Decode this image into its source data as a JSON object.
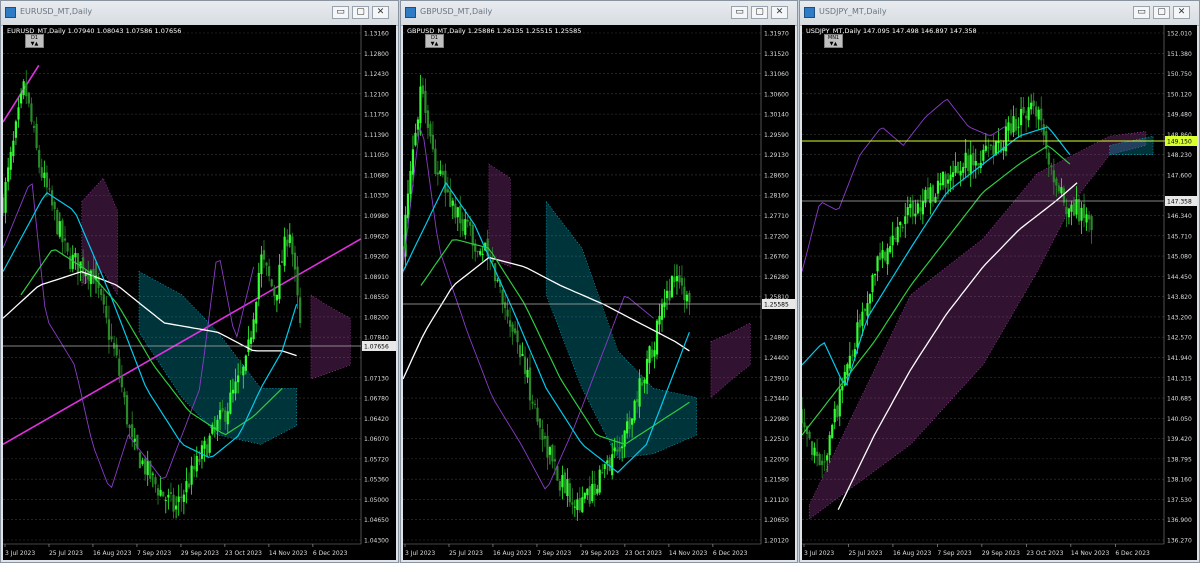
{
  "colors": {
    "background": "#000000",
    "bull": "#32ff32",
    "bear": "#2a8a2a",
    "tenkan": "#00ccee",
    "kijun": "#2ecc40",
    "senkou_ma": "#ffffff",
    "chikou": "#8a3cc8",
    "cloud_up": "#00bcd4",
    "cloud_down": "#b040b0",
    "trendline": "#e030e0",
    "level": "#d8ff30"
  },
  "windows": [
    {
      "id": "eurusd",
      "title": "EURUSD_MT,Daily",
      "symbol_line": "EURUSD_MT,Daily  1.07940 1.08043 1.07586 1.07656",
      "tf_label": "D1",
      "tf_arrows": "▼▲",
      "price_labels": [
        "1.13160",
        "1.12800",
        "1.12430",
        "1.12100",
        "1.11750",
        "1.11390",
        "1.11050",
        "1.10680",
        "1.10330",
        "1.09980",
        "1.09620",
        "1.09260",
        "1.08910",
        "1.08550",
        "1.08200",
        "1.07840",
        "1.07656",
        "1.07130",
        "1.06780",
        "1.06420",
        "1.06070",
        "1.05720",
        "1.05360",
        "1.05000",
        "1.04650",
        "1.04300"
      ],
      "current_price": "1.07656",
      "date_labels": [
        "3 Jul 2023",
        "25 Jul 2023",
        "16 Aug 2023",
        "7 Sep 2023",
        "29 Sep 2023",
        "23 Oct 2023",
        "14 Nov 2023",
        "6 Dec 2023"
      ]
    },
    {
      "id": "gbpusd",
      "title": "GBPUSD_MT,Daily",
      "symbol_line": "GBPUSD_MT,Daily  1.25886 1.26135 1.25515 1.25585",
      "tf_label": "D1",
      "tf_arrows": "▼▲",
      "price_labels": [
        "1.31970",
        "1.31520",
        "1.31060",
        "1.30600",
        "1.30140",
        "1.29590",
        "1.29130",
        "1.28650",
        "1.28160",
        "1.27710",
        "1.27200",
        "1.26760",
        "1.26280",
        "1.25810",
        "1.25585",
        "1.24860",
        "1.24400",
        "1.23910",
        "1.23440",
        "1.22980",
        "1.22510",
        "1.22050",
        "1.21580",
        "1.21120",
        "1.20650",
        "1.20120"
      ],
      "current_price": "1.25585",
      "date_labels": [
        "3 Jul 2023",
        "25 Jul 2023",
        "16 Aug 2023",
        "7 Sep 2023",
        "29 Sep 2023",
        "23 Oct 2023",
        "14 Nov 2023",
        "6 Dec 2023"
      ]
    },
    {
      "id": "usdjpy",
      "title": "USDJPY_MT,Daily",
      "symbol_line": "USDJPY_MT,Daily  147.095 147.498 146.897 147.358",
      "tf_label": "MN1",
      "tf_arrows": "▼▲",
      "price_labels": [
        "152.010",
        "151.380",
        "150.750",
        "150.120",
        "149.480",
        "148.860",
        "148.230",
        "147.600",
        "147.358",
        "146.340",
        "145.710",
        "145.080",
        "144.450",
        "143.820",
        "143.200",
        "142.570",
        "141.940",
        "141.315",
        "140.685",
        "140.050",
        "139.420",
        "138.795",
        "138.160",
        "137.530",
        "136.900",
        "136.270"
      ],
      "current_price": "147.358",
      "level_price": "149.150",
      "date_labels": [
        "3 Jul 2023",
        "25 Jul 2023",
        "16 Aug 2023",
        "7 Sep 2023",
        "29 Sep 2023",
        "23 Oct 2023",
        "14 Nov 2023",
        "6 Dec 2023"
      ]
    }
  ],
  "buttons": {
    "minimize": "▭",
    "maximize": "▢",
    "close": "✕"
  }
}
